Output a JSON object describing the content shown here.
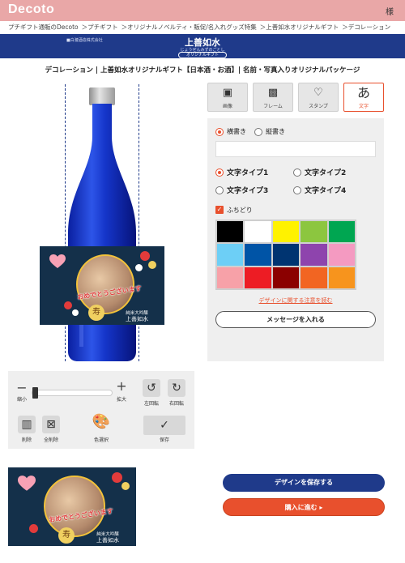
{
  "header": {
    "logo": "Decoto",
    "user_mark": "様"
  },
  "breadcrumb": [
    "プチギフト通販のDecoto",
    "＞プチギフト",
    "＞オリジナルノベルティ・販促/名入れグッズ特集",
    "＞上善如水オリジナルギフト",
    "＞デコレーション"
  ],
  "brand": {
    "company": "■白瀧酒造株式会社",
    "title": "上善如水",
    "subtitle": "じょうぜんみずのごとし",
    "badge": "オリジナルギフト"
  },
  "page_title": "デコレーション | 上善如水オリジナルギフト【日本酒・お酒】| 名前・写真入りオリジナルパッケージ",
  "label": {
    "message": "おめでとうございます",
    "kanji": "寿",
    "product_line1": "純米大吟醸",
    "product_name": "上善如水"
  },
  "tabs": [
    {
      "icon": "image-icon",
      "glyph": "▣",
      "label": "画像"
    },
    {
      "icon": "frame-icon",
      "glyph": "▩",
      "label": "フレーム"
    },
    {
      "icon": "heart-icon",
      "glyph": "♡",
      "label": "スタンプ"
    },
    {
      "icon": "text-icon",
      "glyph": "あ",
      "label": "文字"
    }
  ],
  "text_panel": {
    "orientation_horizontal": "横書き",
    "orientation_vertical": "縦書き",
    "input_value": "",
    "type1": "文字タイプ1",
    "type2": "文字タイプ2",
    "type3": "文字タイプ3",
    "type4": "文字タイプ4",
    "outline_label": "ふちどり",
    "notice_link": "デザインに関する注意を読む",
    "message_button": "メッセージを入れる"
  },
  "palette": [
    "#000000",
    "#ffffff",
    "#fff200",
    "#8cc63f",
    "#00a651",
    "#6dcff6",
    "#0054a6",
    "#003471",
    "#8e44ad",
    "#f49ac1",
    "#f7a1a8",
    "#ed1c24",
    "#8b0000",
    "#f26522",
    "#f7941d"
  ],
  "controls": {
    "zoom_minus": "−",
    "zoom_plus": "+",
    "shrink": "縮小",
    "enlarge": "拡大",
    "rotate_left": "左回転",
    "rotate_right": "右回転",
    "delete": "削除",
    "delete_all": "全削除",
    "color_select": "色選択",
    "save": "保存"
  },
  "actions": {
    "save_design": "デザインを保存する",
    "proceed": "購入に進む ▸"
  }
}
